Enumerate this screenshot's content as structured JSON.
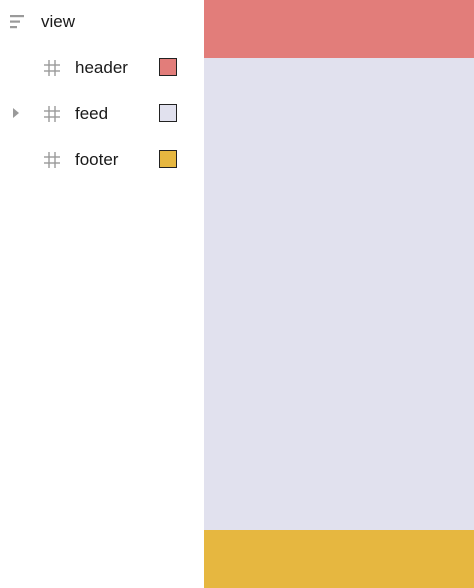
{
  "tree": {
    "root": {
      "label": "view",
      "icon": "layers-icon"
    },
    "items": [
      {
        "label": "header",
        "icon": "hash-icon",
        "color": "#e27d7a",
        "expandable": false
      },
      {
        "label": "feed",
        "icon": "hash-icon",
        "color": "#e1e1ee",
        "expandable": true
      },
      {
        "label": "footer",
        "icon": "hash-icon",
        "color": "#e6b740",
        "expandable": false
      }
    ]
  },
  "canvas": {
    "blocks": [
      {
        "name": "header",
        "color": "#e27d7a"
      },
      {
        "name": "feed",
        "color": "#e1e1ee"
      },
      {
        "name": "footer",
        "color": "#e6b740"
      }
    ]
  }
}
